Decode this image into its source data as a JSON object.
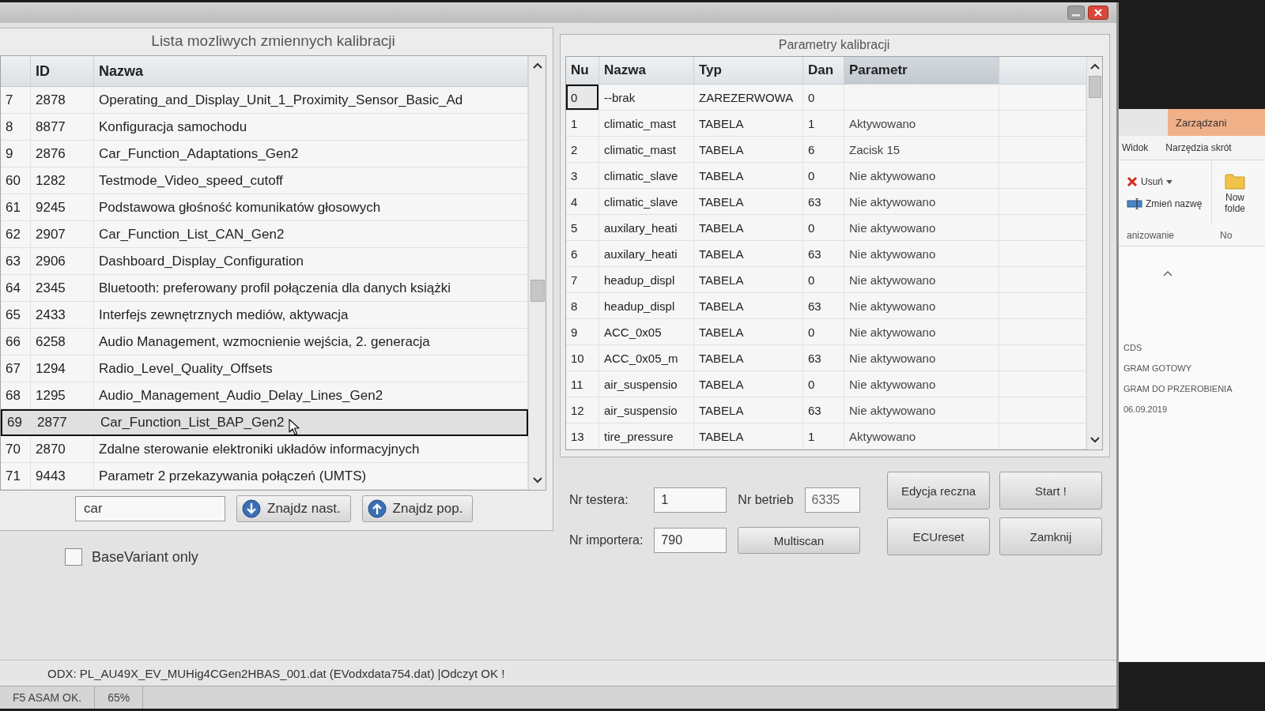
{
  "calibration_list": {
    "title": "Lista mozliwych zmiennych kalibracji",
    "columns": [
      "ID",
      "Nazwa"
    ],
    "rows": [
      {
        "column_1": "7",
        "id": "2878",
        "name": "Operating_and_Display_Unit_1_Proximity_Sensor_Basic_Ad",
        "selected": false
      },
      {
        "column_1": "8",
        "id": "8877",
        "name": "Konfiguracja samochodu",
        "selected": false
      },
      {
        "column_1": "9",
        "id": "2876",
        "name": "Car_Function_Adaptations_Gen2",
        "selected": false
      },
      {
        "column_1": "60",
        "id": "1282",
        "name": "Testmode_Video_speed_cutoff",
        "selected": false
      },
      {
        "column_1": "61",
        "id": "9245",
        "name": "Podstawowa głośność komunikatów głosowych",
        "selected": false
      },
      {
        "column_1": "62",
        "id": "2907",
        "name": "Car_Function_List_CAN_Gen2",
        "selected": false
      },
      {
        "column_1": "63",
        "id": "2906",
        "name": "Dashboard_Display_Configuration",
        "selected": false
      },
      {
        "column_1": "64",
        "id": "2345",
        "name": "Bluetooth: preferowany profil połączenia dla danych książki",
        "selected": false
      },
      {
        "column_1": "65",
        "id": "2433",
        "name": "Interfejs zewnętrznych mediów, aktywacja",
        "selected": false
      },
      {
        "column_1": "66",
        "id": "6258",
        "name": "Audio Management, wzmocnienie wejścia, 2. generacja",
        "selected": false
      },
      {
        "column_1": "67",
        "id": "1294",
        "name": "Radio_Level_Quality_Offsets",
        "selected": false
      },
      {
        "column_1": "68",
        "id": "1295",
        "name": "Audio_Management_Audio_Delay_Lines_Gen2",
        "selected": false
      },
      {
        "column_1": "69",
        "id": "2877",
        "name": "Car_Function_List_BAP_Gen2",
        "selected": true
      },
      {
        "column_1": "70",
        "id": "2870",
        "name": "Zdalne sterowanie elektroniki układów informacyjnych",
        "selected": false
      },
      {
        "column_1": "71",
        "id": "9443",
        "name": "Parametr 2 przekazywania połączeń (UMTS)",
        "selected": false
      }
    ],
    "search": {
      "value": "car"
    },
    "buttons": [
      {
        "label": "Znajdz nast.",
        "kind": "next"
      },
      {
        "label": "Znajdz pop.",
        "kind": "previous"
      }
    ]
  },
  "base_variant_only": {
    "label": "BaseVariant only",
    "checked": false
  },
  "calibration_parameters": {
    "title": "Parametry kalibracji",
    "columns": [
      "Nu",
      "Nazwa",
      "Typ",
      "Dan",
      "Parametr"
    ],
    "rows": [
      {
        "nu": "0",
        "name": "--brak",
        "type": "ZAREZERWOWA",
        "data": "0",
        "selected": true
      },
      {
        "nu": "1",
        "name": "climatic_mast",
        "type": "TABELA",
        "data": "1",
        "parameter": "Aktywowano",
        "selected": false
      },
      {
        "nu": "2",
        "name": "climatic_mast",
        "type": "TABELA",
        "data": "6",
        "parameter": "Zacisk 15",
        "selected": false
      },
      {
        "nu": "3",
        "name": "climatic_slave",
        "type": "TABELA",
        "data": "0",
        "parameter": "Nie aktywowano",
        "selected": false
      },
      {
        "nu": "4",
        "name": "climatic_slave",
        "type": "TABELA",
        "data": "63",
        "parameter": "Nie aktywowano",
        "selected": false
      },
      {
        "nu": "5",
        "name": "auxilary_heati",
        "type": "TABELA",
        "data": "0",
        "parameter": "Nie aktywowano",
        "selected": false
      },
      {
        "nu": "6",
        "name": "auxilary_heati",
        "type": "TABELA",
        "data": "63",
        "parameter": "Nie aktywowano",
        "selected": false
      },
      {
        "nu": "7",
        "name": "headup_displ",
        "type": "TABELA",
        "data": "0",
        "parameter": "Nie aktywowano",
        "selected": false
      },
      {
        "nu": "8",
        "name": "headup_displ",
        "type": "TABELA",
        "data": "63",
        "parameter": "Nie aktywowano",
        "selected": false
      },
      {
        "nu": "9",
        "name": "ACC_0x05",
        "type": "TABELA",
        "data": "0",
        "parameter": "Nie aktywowano",
        "selected": false
      },
      {
        "nu": "10",
        "name": "ACC_0x05_m",
        "type": "TABELA",
        "data": "63",
        "parameter": "Nie aktywowano",
        "selected": false
      },
      {
        "nu": "11",
        "name": "air_suspensio",
        "type": "TABELA",
        "data": "0",
        "parameter": "Nie aktywowano",
        "selected": false
      },
      {
        "nu": "12",
        "name": "air_suspensio",
        "type": "TABELA",
        "data": "63",
        "parameter": "Nie aktywowano",
        "selected": false
      },
      {
        "nu": "13",
        "name": "tire_pressure",
        "type": "TABELA",
        "data": "1",
        "parameter": "Aktywowano",
        "selected": false
      }
    ]
  },
  "form": {
    "fields": [
      {
        "label": "Nr testera:",
        "value": "1"
      },
      {
        "label": "Nr betrieb",
        "value": "6335"
      },
      {
        "label": "Nr importera:",
        "value": "790"
      }
    ],
    "scan_button": "Multiscan",
    "actions": [
      "Edycja reczna",
      "Start !",
      "ECUreset",
      "Zamknij"
    ]
  },
  "status_bar": {
    "message": "ODX: PL_AU49X_EV_MUHig4CGen2HBAS_001.dat (EVodxdata754.dat) |Odczyt OK !",
    "segments": [
      "F5 ASAM OK.",
      "65%"
    ]
  },
  "explorer": {
    "context_tab": "Zarządzani",
    "tabs": [
      "Widok",
      "Narzędzia skrót"
    ],
    "commands": [
      {
        "kind": "delete",
        "label": "Usuń"
      },
      {
        "kind": "rename",
        "label": "Zmień nazwę"
      },
      {
        "kind": "new-folder",
        "label": "Now folde"
      }
    ],
    "groups": [
      "anizowanie",
      "No"
    ],
    "items": [
      "CDS",
      "GRAM GOTOWY",
      "GRAM DO PRZEROBIENIA",
      "06.09.2019"
    ]
  }
}
